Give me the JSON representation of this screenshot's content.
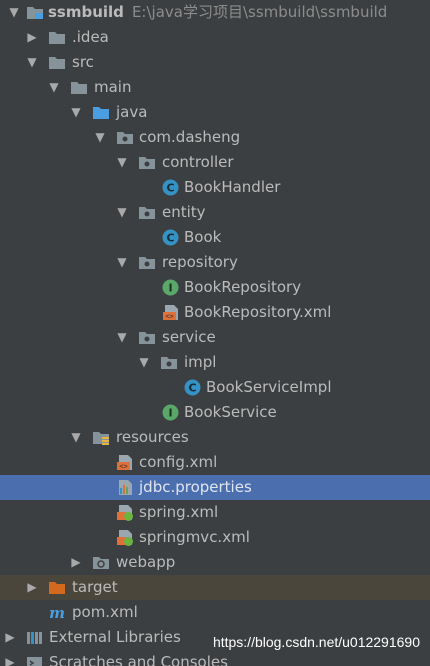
{
  "project": {
    "name": "ssmbuild",
    "path": "E:\\java学习项目\\ssmbuild\\ssmbuild"
  },
  "tree": {
    "idea": ".idea",
    "src": "src",
    "main": "main",
    "java": "java",
    "pkg": "com.dasheng",
    "controller": "controller",
    "book_handler": "BookHandler",
    "entity": "entity",
    "book": "Book",
    "repository": "repository",
    "book_repository": "BookRepository",
    "book_repository_xml": "BookRepository.xml",
    "service": "service",
    "impl": "impl",
    "book_service_impl": "BookServiceImpl",
    "book_service": "BookService",
    "resources": "resources",
    "config_xml": "config.xml",
    "jdbc_properties": "jdbc.properties",
    "spring_xml": "spring.xml",
    "springmvc_xml": "springmvc.xml",
    "webapp": "webapp",
    "target": "target",
    "pom_xml": "pom.xml",
    "external_libraries": "External Libraries",
    "scratches": "Scratches and Consoles"
  },
  "watermark": "https://blog.csdn.net/u012291690",
  "colors": {
    "background": "#3c3f41",
    "selection": "#4b6eaf",
    "excluded_row": "#4a463c",
    "folder": "#87939a",
    "source_folder": "#4a9ee0",
    "class_icon": "#3592c4",
    "interface_icon": "#59a869",
    "excluded_folder": "#d2691e"
  }
}
